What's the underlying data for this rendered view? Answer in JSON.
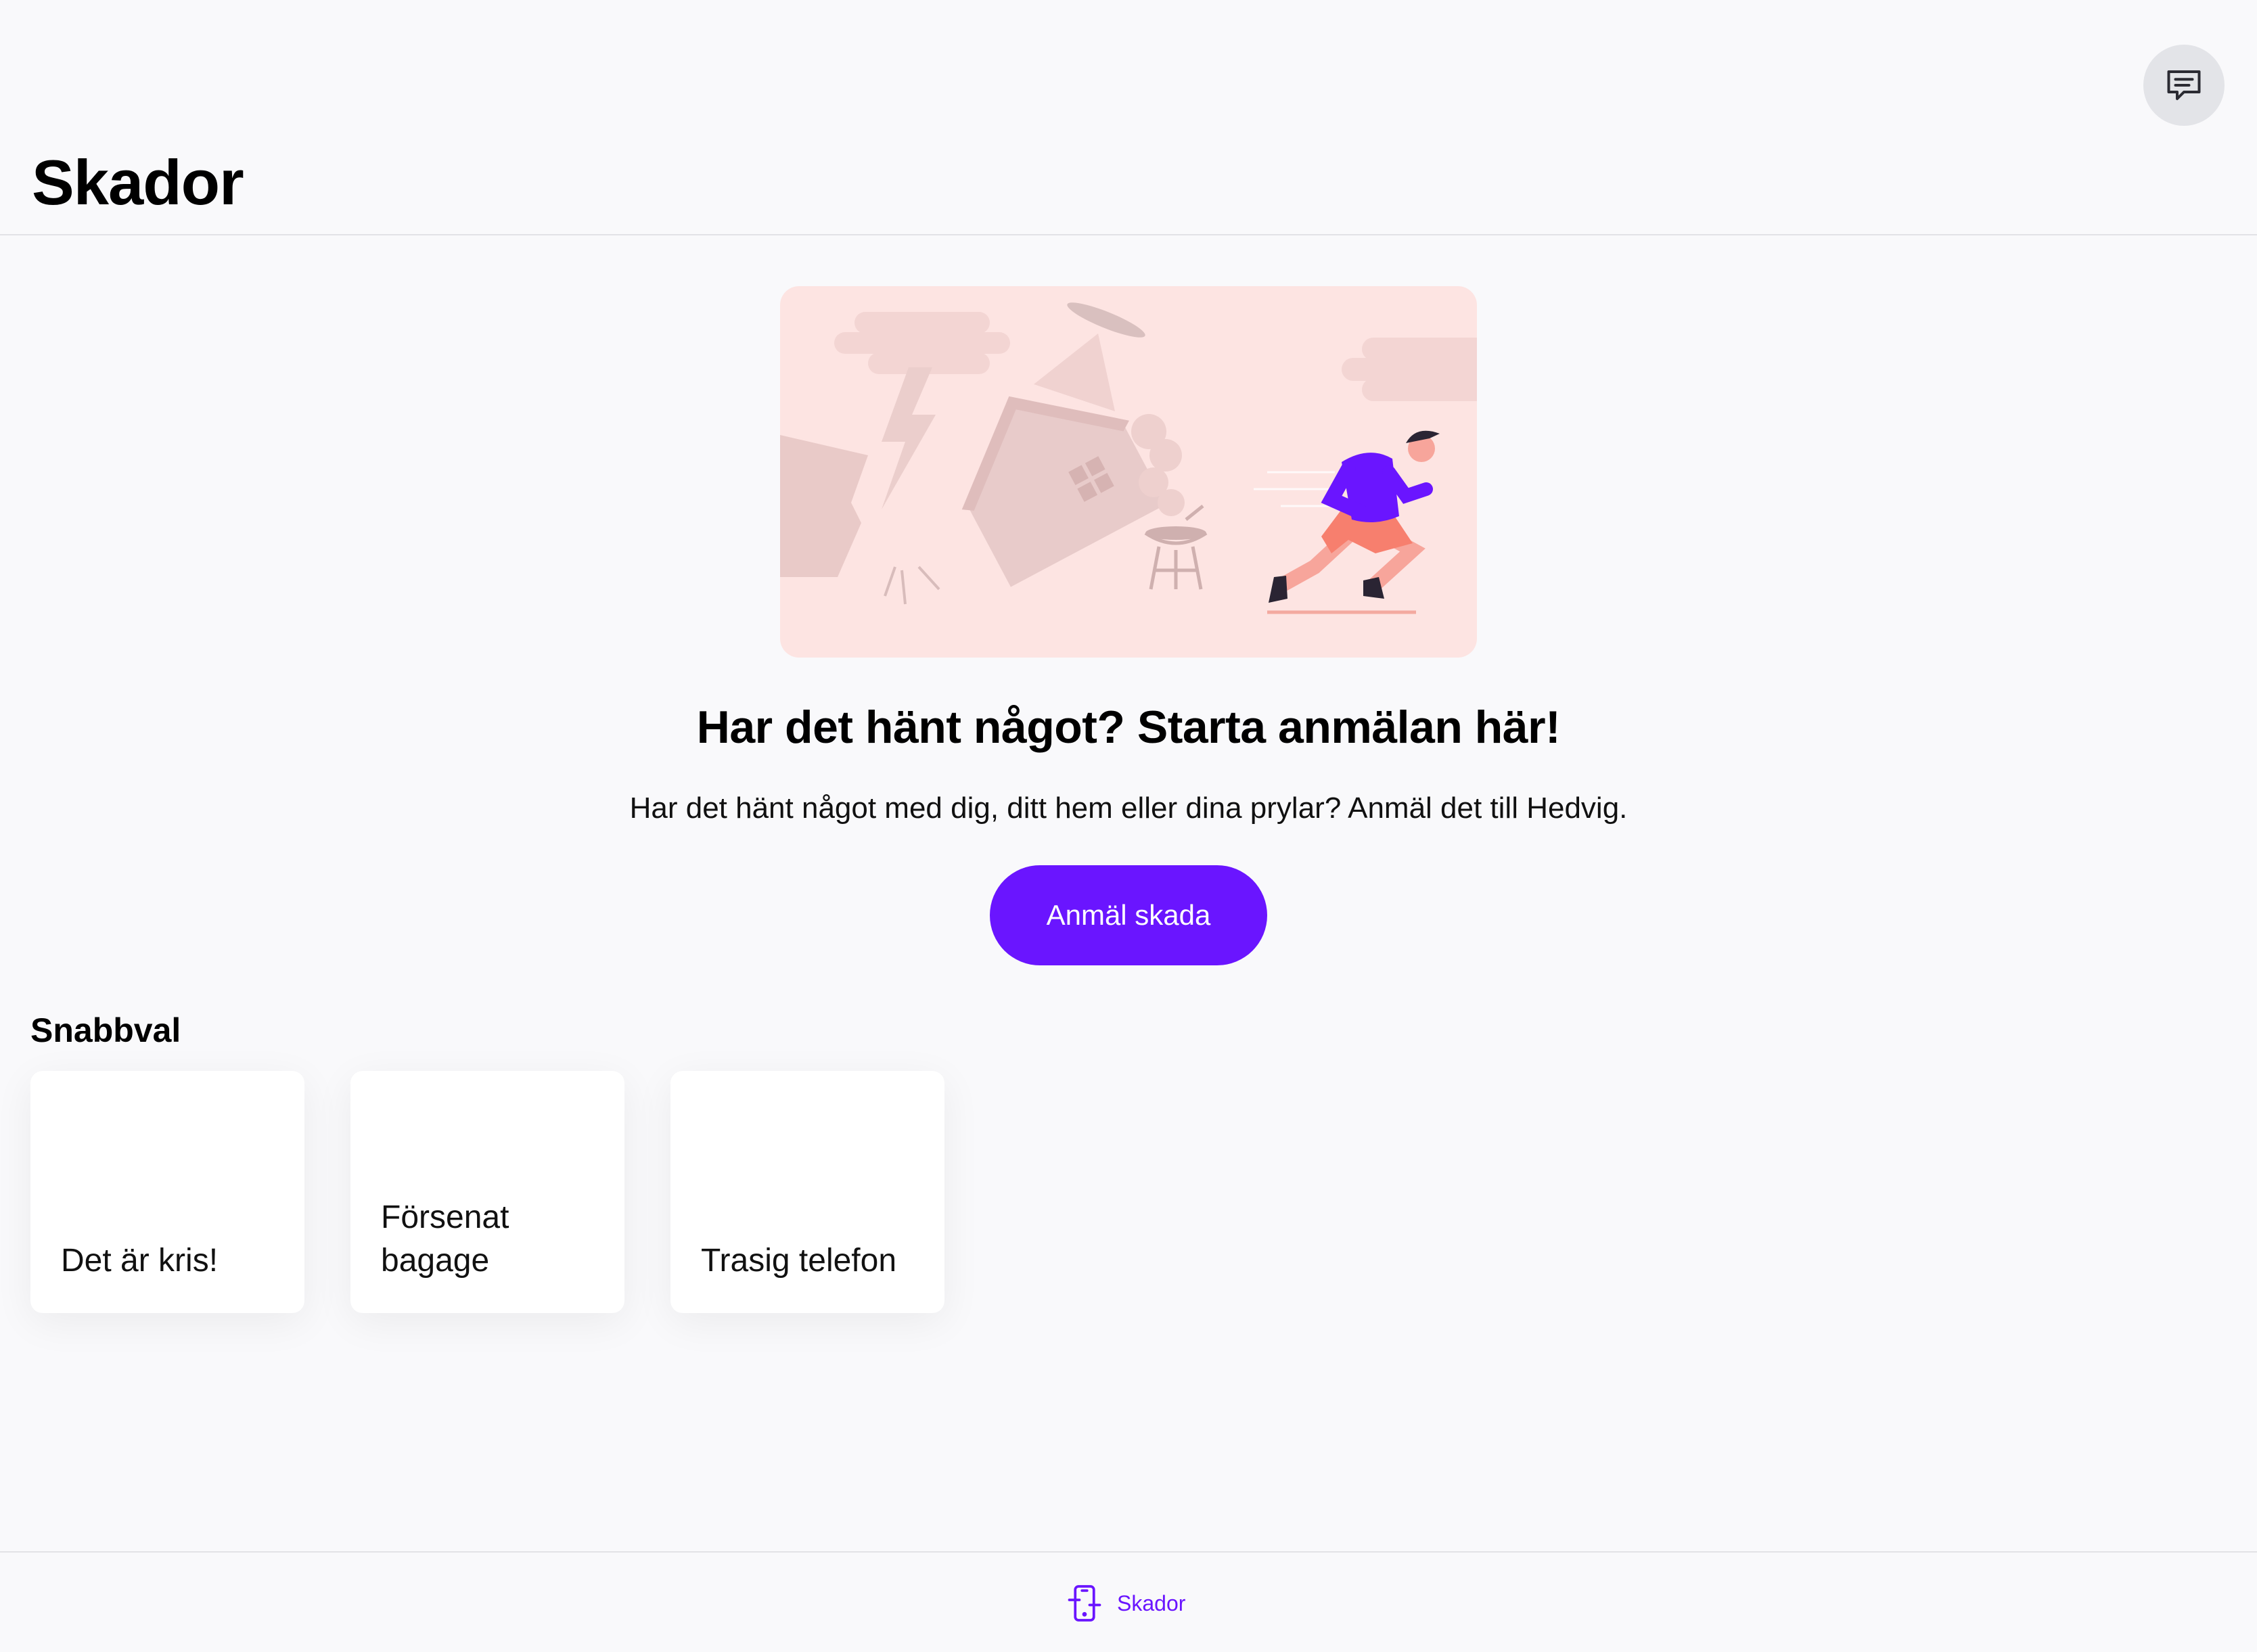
{
  "header": {
    "title": "Skador",
    "chat_icon": "chat-icon"
  },
  "hero": {
    "illustration": "disaster-runner-illustration",
    "headline": "Har det hänt något? Starta anmälan här!",
    "subtext": "Har det hänt något med dig, ditt hem eller dina prylar? Anmäl det till Hedvig.",
    "cta_label": "Anmäl skada"
  },
  "quick": {
    "title": "Snabbval",
    "cards": [
      {
        "label": "Det är kris!"
      },
      {
        "label": "Försenat bagage"
      },
      {
        "label": "Trasig telefon"
      }
    ]
  },
  "nav": {
    "items": [
      {
        "label": "Skador",
        "icon": "phone-claim-icon"
      }
    ]
  },
  "colors": {
    "accent": "#6a15ff",
    "hero_bg": "#fde4e2",
    "page_bg": "#f9f9fb"
  }
}
